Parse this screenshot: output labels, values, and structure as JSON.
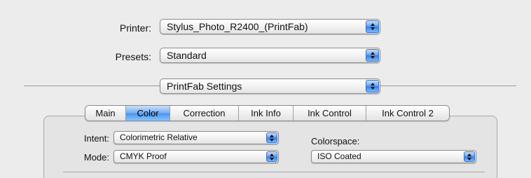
{
  "printer": {
    "label": "Printer:",
    "value": "Stylus_Photo_R2400_(PrintFab)"
  },
  "presets": {
    "label": "Presets:",
    "value": "Standard"
  },
  "section": {
    "value": "PrintFab Settings"
  },
  "tabs": [
    {
      "label": "Main",
      "active": false
    },
    {
      "label": "Color",
      "active": true
    },
    {
      "label": "Correction",
      "active": false
    },
    {
      "label": "Ink Info",
      "active": false
    },
    {
      "label": "Ink Control",
      "active": false
    },
    {
      "label": "Ink Control 2",
      "active": false
    }
  ],
  "color_panel": {
    "intent": {
      "label": "Intent:",
      "value": "Colorimetric Relative"
    },
    "mode": {
      "label": "Mode:",
      "value": "CMYK Proof"
    },
    "colorspace": {
      "label": "Colorspace:",
      "value": "ISO Coated"
    }
  },
  "colors": {
    "accent": "#4b92ee",
    "window_bg": "#ececec"
  }
}
